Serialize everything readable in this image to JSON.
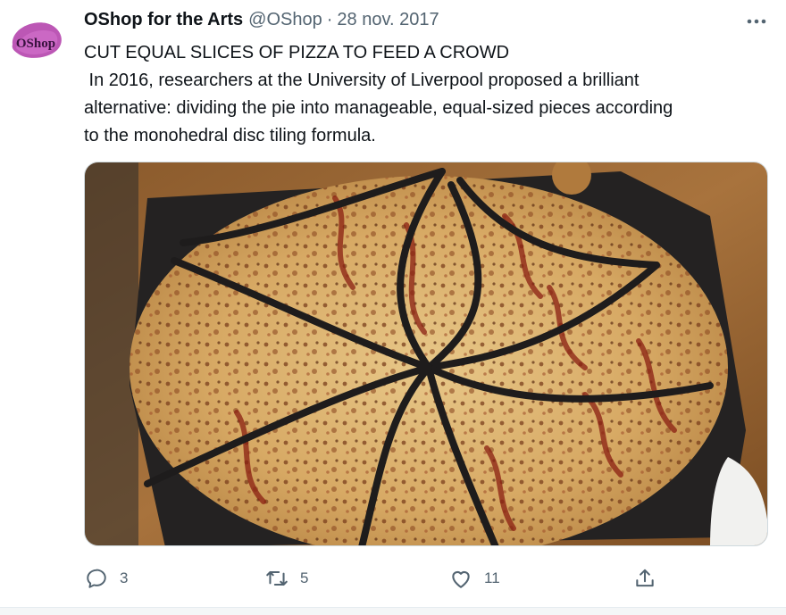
{
  "author": {
    "display_name": "OShop for the Arts",
    "handle": "@OShop",
    "separator": "·",
    "date": "28 nov. 2017",
    "avatar_text": "OShop"
  },
  "more_icon": "more-dots-icon",
  "tweet": {
    "lines": [
      "CUT EQUAL SLICES OF PIZZA TO FEED A CROWD",
      " In 2016, researchers at the University of Liverpool proposed a brilliant",
      "alternative: dividing the pie into manageable, equal-sized pieces according",
      "to the monohedral disc tiling formula."
    ]
  },
  "media": {
    "alt": "Pizza cut into curved, equal-sized slices on a dark board"
  },
  "actions": {
    "reply": {
      "icon": "reply-icon",
      "count": "3"
    },
    "retweet": {
      "icon": "retweet-icon",
      "count": "5"
    },
    "like": {
      "icon": "heart-icon",
      "count": "11"
    },
    "share": {
      "icon": "share-icon"
    }
  },
  "colors": {
    "text_primary": "#0f1419",
    "text_secondary": "#536471",
    "avatar_brand": "#8b2a8f"
  }
}
